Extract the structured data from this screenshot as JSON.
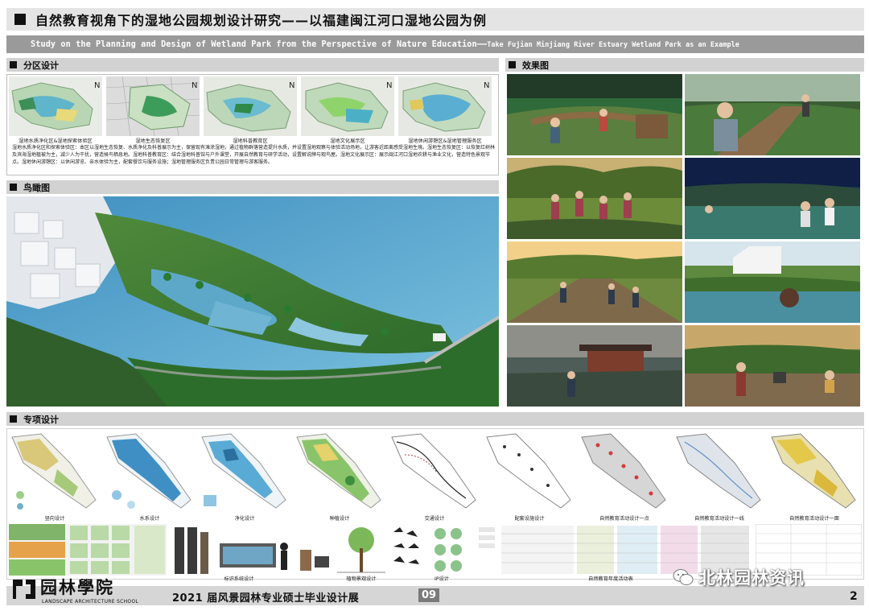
{
  "header": {
    "title_cn": "自然教育视角下的湿地公园规划设计研究——以福建闽江河口湿地公园为例",
    "subtitle_en_main": "Study on the Planning and Design of Wetland Park from the Perspective of Nature Education——",
    "subtitle_en_tail": "Take Fujian Minjiang River Estuary Wetland Park as an Example"
  },
  "sections": {
    "zoning": "分区设计",
    "aerial": "鸟瞰图",
    "renders": "效果图",
    "special": "专项设计"
  },
  "zoning": {
    "captions": [
      "湿地水质净化区&湿地探索体验区",
      "湿地生态恢复区",
      "湿地科普教育区",
      "湿地文化展示区",
      "湿地休闲游憩区&湿地管理服务区"
    ],
    "paragraph": "湿地水质净化区和探索体验区：本区以湿地生态恢复、水质净化及科普展示为主，保留现有滩涂湿地，通过植物群落营造提升水质，并设置湿地观察与体验活动场地，让游客近距离感受湿地生境。湿地生态恢复区：以恢复红树林及滨海湿地植被为主，减少人为干扰，营造候鸟栖息地。湿地科普教育区：结合湿地科普馆与户外课堂，开展自然教育与研学活动，设置解说牌与观鸟屋。湿地文化展示区：展示闽江河口湿地农耕与渔业文化，营造特色景观节点。湿地休闲游憩区：以休闲游览、亲水体验为主，配套餐饮与服务设施；湿地管理服务区负责公园日常管理与游客服务。"
  },
  "special": {
    "plan_captions": [
      "竖向设计",
      "水系设计",
      "净化设计",
      "种植设计",
      "交通设计",
      "配套设施设计",
      "自然教育活动设计一点",
      "自然教育活动设计一线",
      "自然教育活动设计一面"
    ],
    "row2_captions": [
      "标识系统设计",
      "植物景观设计",
      "IP设计",
      "自然教育年度活动表"
    ]
  },
  "footer": {
    "logo_cn": "园林學院",
    "logo_en": "LANDSCAPE ARCHITECTURE SCHOOL",
    "exhibit_title": "2021 届风景园林专业硕士毕业设计展",
    "code": "09",
    "page": "2",
    "watermark": "北林园林资讯"
  }
}
